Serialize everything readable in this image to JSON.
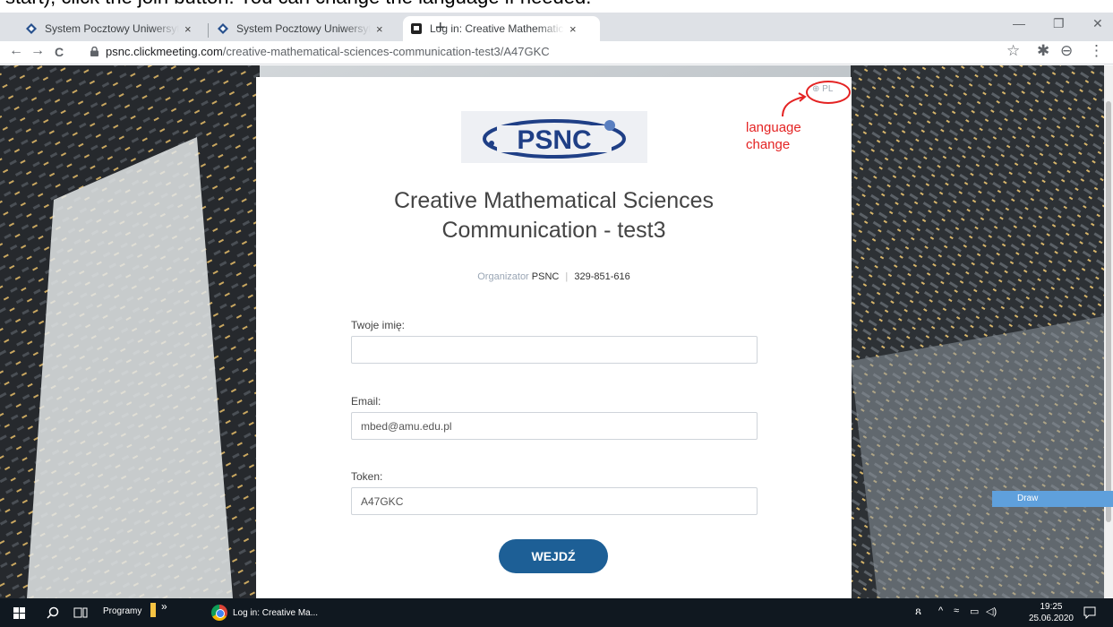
{
  "caption": "start), click the join button. You can change the language if needed.",
  "browser": {
    "tabs": [
      {
        "title": "System Pocztowy Uniwersytetu im",
        "close": "×"
      },
      {
        "title": "System Pocztowy Uniwersytetu im",
        "close": "×"
      },
      {
        "title": "Log in: Creative Mathematical Sc",
        "close": "×"
      }
    ],
    "new_tab": "+",
    "window": {
      "minimize": "—",
      "restore": "❐",
      "close": "✕"
    },
    "url_host": "psnc.clickmeeting.com",
    "url_path": "/creative-mathematical-sciences-communication-test3/A47GKC",
    "nav": {
      "back": "←",
      "forward": "→",
      "reload": "C"
    },
    "icons": {
      "star": "☆",
      "extensions": "✱",
      "profile": "⊖",
      "menu": "⋮"
    }
  },
  "page": {
    "logo_text": "PSNC",
    "language": "PL",
    "title_line1": "Creative Mathematical Sciences",
    "title_line2": "Communication - test3",
    "organizer_label": "Organizator",
    "organizer_name": "PSNC",
    "meeting_id": "329-851-616",
    "name_label": "Twoje imię:",
    "name_value": "",
    "email_label": "Email:",
    "email_value": "mbed@amu.edu.pl",
    "token_label": "Token:",
    "token_value": "A47GKC",
    "join_button": "WEJDŹ"
  },
  "annotation": {
    "line1": "language",
    "line2": "change",
    "color": "#e42323"
  },
  "draw_tab": "Draw",
  "taskbar": {
    "programs_label": "Programy",
    "chevron": "»",
    "app_label": "Log in: Creative Ma...",
    "time": "19:25",
    "date": "25.06.2020"
  },
  "colors": {
    "join_button": "#1d5f96",
    "taskbar": "#101820"
  }
}
